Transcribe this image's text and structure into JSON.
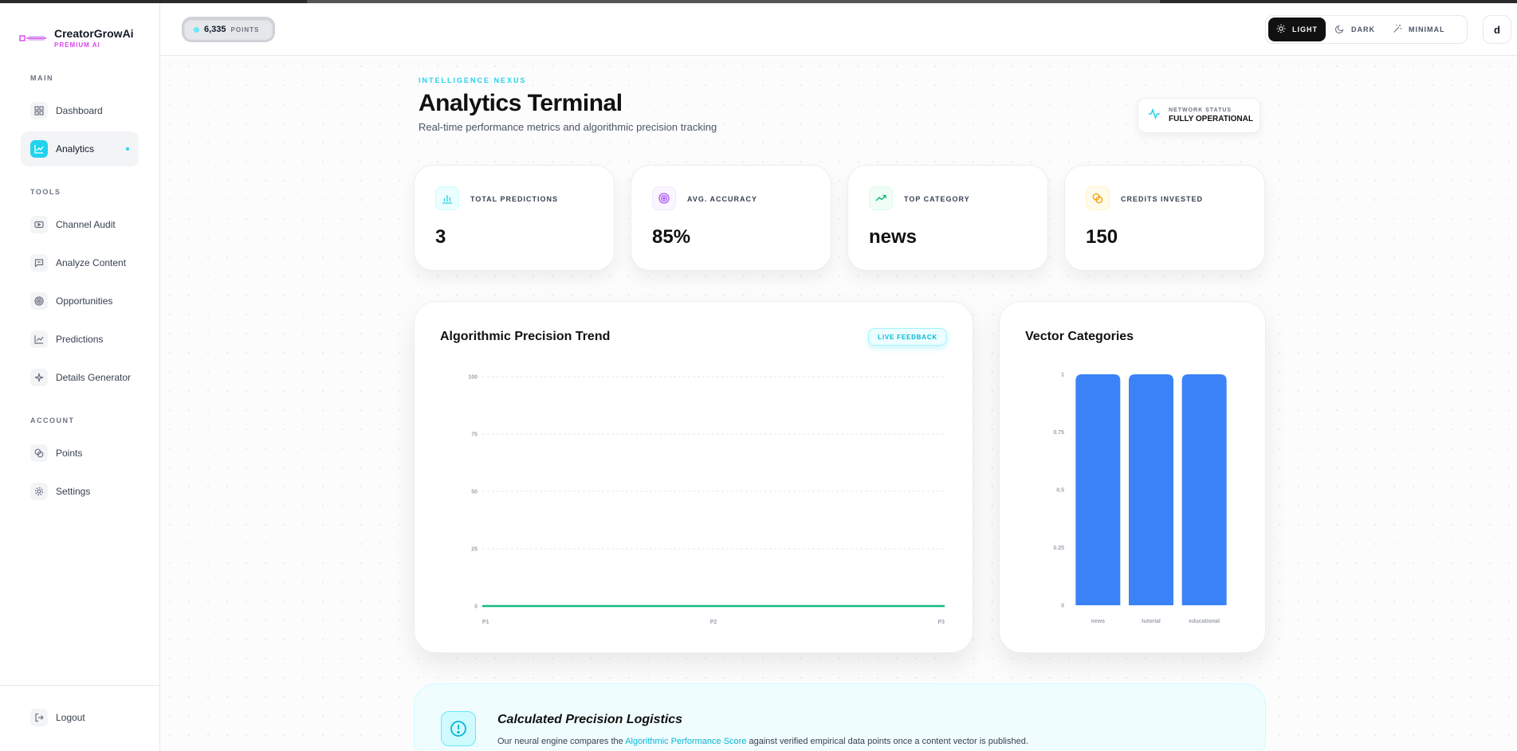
{
  "app": {
    "name": "CreatorGrowAi",
    "tier": "PREMIUM AI"
  },
  "sidebar": {
    "sections": {
      "main": "MAIN",
      "tools": "TOOLS",
      "account": "ACCOUNT"
    },
    "items": [
      {
        "label": "Dashboard",
        "icon": "grid-icon"
      },
      {
        "label": "Analytics",
        "icon": "chart-line-icon",
        "active": true
      },
      {
        "label": "Channel Audit",
        "icon": "play-icon"
      },
      {
        "label": "Analyze Content",
        "icon": "message-icon"
      },
      {
        "label": "Opportunities",
        "icon": "target-icon"
      },
      {
        "label": "Predictions",
        "icon": "chart-line-icon"
      },
      {
        "label": "Details Generator",
        "icon": "sparkles-icon"
      },
      {
        "label": "Points",
        "icon": "coins-icon"
      },
      {
        "label": "Settings",
        "icon": "gear-icon"
      }
    ],
    "logout": "Logout"
  },
  "header": {
    "points_value": "6,335",
    "points_label": "POINTS",
    "themes": {
      "light": "LIGHT",
      "dark": "DARK",
      "minimal": "MINIMAL"
    },
    "active_theme": "light",
    "avatar_initial": "d"
  },
  "main": {
    "eyebrow": "INTELLIGENCE NEXUS",
    "title": "Analytics Terminal",
    "subtitle": "Real-time performance metrics and algorithmic precision tracking",
    "network_status": {
      "label": "NETWORK STATUS",
      "value": "FULLY OPERATIONAL"
    },
    "stats": [
      {
        "label": "TOTAL PREDICTIONS",
        "value": "3",
        "icon": "bar-chart-icon"
      },
      {
        "label": "AVG. ACCURACY",
        "value": "85%",
        "icon": "target-icon"
      },
      {
        "label": "TOP CATEGORY",
        "value": "news",
        "icon": "trending-up-icon"
      },
      {
        "label": "CREDITS INVESTED",
        "value": "150",
        "icon": "coins-icon"
      }
    ],
    "trend_panel": {
      "title": "Algorithmic Precision Trend",
      "badge": "LIVE FEEDBACK"
    },
    "categories_panel": {
      "title": "Vector Categories"
    },
    "logistics": {
      "title": "Calculated Precision Logistics",
      "text_before": "Our neural engine compares the ",
      "text_highlight": "Algorithmic Performance Score",
      "text_after": " against verified empirical data points once a content vector is published."
    }
  },
  "colors": {
    "accent": "#22d3ee",
    "brand_pink": "#d946ef",
    "line": "#10b981",
    "bar": "#3b82f6"
  },
  "chart_data": [
    {
      "type": "line",
      "title": "Algorithmic Precision Trend",
      "x": [
        "P1",
        "P2",
        "P3"
      ],
      "series": [
        {
          "values": [
            0,
            0,
            0
          ]
        }
      ],
      "yticks": [
        "0",
        "25",
        "50",
        "75",
        "100"
      ],
      "ylim": [
        0,
        100
      ],
      "grid": true
    },
    {
      "type": "bar",
      "title": "Vector Categories",
      "categories": [
        "news",
        "tutorial",
        "educational"
      ],
      "values": [
        1,
        1,
        1
      ],
      "yticks": [
        "0",
        "0.25",
        "0.5",
        "0.75",
        "1"
      ],
      "ylim": [
        0,
        1
      ],
      "grid": false
    }
  ]
}
